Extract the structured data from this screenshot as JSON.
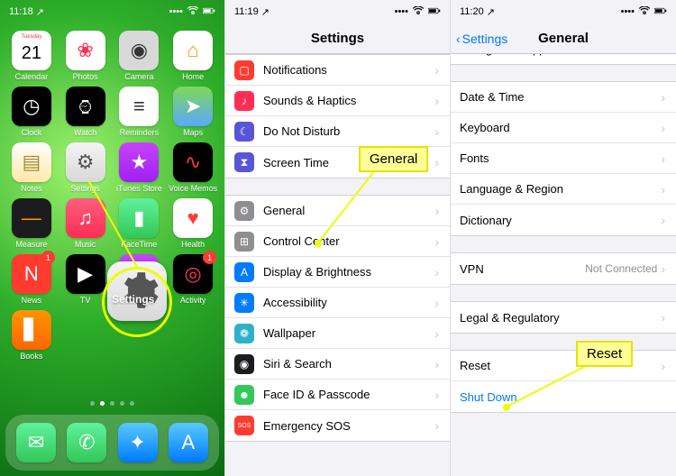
{
  "panel1": {
    "time": "11:18",
    "location_icon": "▸",
    "apps": [
      {
        "label": "Calendar",
        "bg": "#ffffff",
        "glyph": "21",
        "glyph_color": "#000",
        "day": "Tuesday"
      },
      {
        "label": "Photos",
        "bg": "#ffffff",
        "glyph": "❀",
        "glyph_color": "#ff2d55"
      },
      {
        "label": "Camera",
        "bg": "#d8d8d8",
        "glyph": "◉",
        "glyph_color": "#333"
      },
      {
        "label": "Home",
        "bg": "#ffffff",
        "glyph": "⌂",
        "glyph_color": "#ff9500"
      },
      {
        "label": "Clock",
        "bg": "#000000",
        "glyph": "◷",
        "glyph_color": "#fff"
      },
      {
        "label": "Watch",
        "bg": "#000000",
        "glyph": "⌚︎",
        "glyph_color": "#fff"
      },
      {
        "label": "Reminders",
        "bg": "#ffffff",
        "glyph": "≡",
        "glyph_color": "#333"
      },
      {
        "label": "Maps",
        "bg": "linear-gradient(#7ed957,#59a8ff)",
        "glyph": "➤",
        "glyph_color": "#fff"
      },
      {
        "label": "Notes",
        "bg": "linear-gradient(#fff,#ffe9a6)",
        "glyph": "▤",
        "glyph_color": "#a08b3a"
      },
      {
        "label": "Settings",
        "bg": "linear-gradient(#f4f4f4,#d8d8d8)",
        "glyph": "⚙",
        "glyph_color": "#555"
      },
      {
        "label": "iTunes Store",
        "bg": "linear-gradient(#c644fc,#a020f0)",
        "glyph": "★",
        "glyph_color": "#fff"
      },
      {
        "label": "Voice Memos",
        "bg": "#000000",
        "glyph": "∿",
        "glyph_color": "#ff3b30"
      },
      {
        "label": "Measure",
        "bg": "#1c1c1e",
        "glyph": "—",
        "glyph_color": "#ff9500"
      },
      {
        "label": "Music",
        "bg": "linear-gradient(#ff5e7e,#ff2d55)",
        "glyph": "♫",
        "glyph_color": "#fff"
      },
      {
        "label": "FaceTime",
        "bg": "linear-gradient(#5ef29b,#34c759)",
        "glyph": "▮",
        "glyph_color": "#fff"
      },
      {
        "label": "Health",
        "bg": "#ffffff",
        "glyph": "♥",
        "glyph_color": "#ff3b30"
      },
      {
        "label": "News",
        "bg": "linear-gradient(#ff3b30,#ff3b30)",
        "glyph": "N",
        "glyph_color": "#fff",
        "badge": "1"
      },
      {
        "label": "TV",
        "bg": "#000000",
        "glyph": "▶",
        "glyph_color": "#fff"
      },
      {
        "label": "Podcasts",
        "bg": "linear-gradient(#c644fc,#8e44e0)",
        "glyph": "◉",
        "glyph_color": "#fff"
      },
      {
        "label": "Activity",
        "bg": "#000000",
        "glyph": "◎",
        "glyph_color": "#ff375f",
        "badge": "1"
      },
      {
        "label": "Books",
        "bg": "linear-gradient(#ff9500,#ff6600)",
        "glyph": "▋",
        "glyph_color": "#fff"
      }
    ],
    "dock": [
      {
        "name": "messages-icon",
        "bg": "linear-gradient(#5ef29b,#34c759)",
        "glyph": "✉︎"
      },
      {
        "name": "phone-icon",
        "bg": "linear-gradient(#5ef29b,#34c759)",
        "glyph": "✆"
      },
      {
        "name": "safari-icon",
        "bg": "linear-gradient(#58c9ff,#007aff)",
        "glyph": "✦"
      },
      {
        "name": "appstore-icon",
        "bg": "linear-gradient(#58c9ff,#007aff)",
        "glyph": "A"
      }
    ],
    "highlight_label": "Settings"
  },
  "panel2": {
    "time": "11:19",
    "title": "Settings",
    "groups": [
      [
        {
          "icon_bg": "#ff3b30",
          "glyph": "▢",
          "label": "Notifications"
        },
        {
          "icon_bg": "#ff2d55",
          "glyph": "♪",
          "label": "Sounds & Haptics"
        },
        {
          "icon_bg": "#5856d6",
          "glyph": "☾",
          "label": "Do Not Disturb"
        },
        {
          "icon_bg": "#5856d6",
          "glyph": "⧗",
          "label": "Screen Time"
        }
      ],
      [
        {
          "icon_bg": "#8e8e93",
          "glyph": "⚙",
          "label": "General"
        },
        {
          "icon_bg": "#8e8e93",
          "glyph": "⊞",
          "label": "Control Center"
        },
        {
          "icon_bg": "#007aff",
          "glyph": "A",
          "label": "Display & Brightness"
        },
        {
          "icon_bg": "#007aff",
          "glyph": "✳︎",
          "label": "Accessibility"
        },
        {
          "icon_bg": "#30b0c7",
          "glyph": "❁",
          "label": "Wallpaper"
        },
        {
          "icon_bg": "#1c1c1e",
          "glyph": "◉",
          "label": "Siri & Search"
        },
        {
          "icon_bg": "#34c759",
          "glyph": "☻",
          "label": "Face ID & Passcode"
        },
        {
          "icon_bg": "#ff3b30",
          "glyph": "SOS",
          "label": "Emergency SOS"
        }
      ]
    ],
    "callout": "General"
  },
  "panel3": {
    "time": "11:20",
    "back": "Settings",
    "title": "General",
    "groups": [
      [
        {
          "label": "Background App Refresh"
        }
      ],
      [
        {
          "label": "Date & Time"
        },
        {
          "label": "Keyboard"
        },
        {
          "label": "Fonts"
        },
        {
          "label": "Language & Region"
        },
        {
          "label": "Dictionary"
        }
      ],
      [
        {
          "label": "VPN",
          "value": "Not Connected"
        }
      ],
      [
        {
          "label": "Legal & Regulatory"
        }
      ],
      [
        {
          "label": "Reset"
        },
        {
          "label": "Shut Down",
          "link": true,
          "no_chevron": true
        }
      ]
    ],
    "callout": "Reset"
  }
}
